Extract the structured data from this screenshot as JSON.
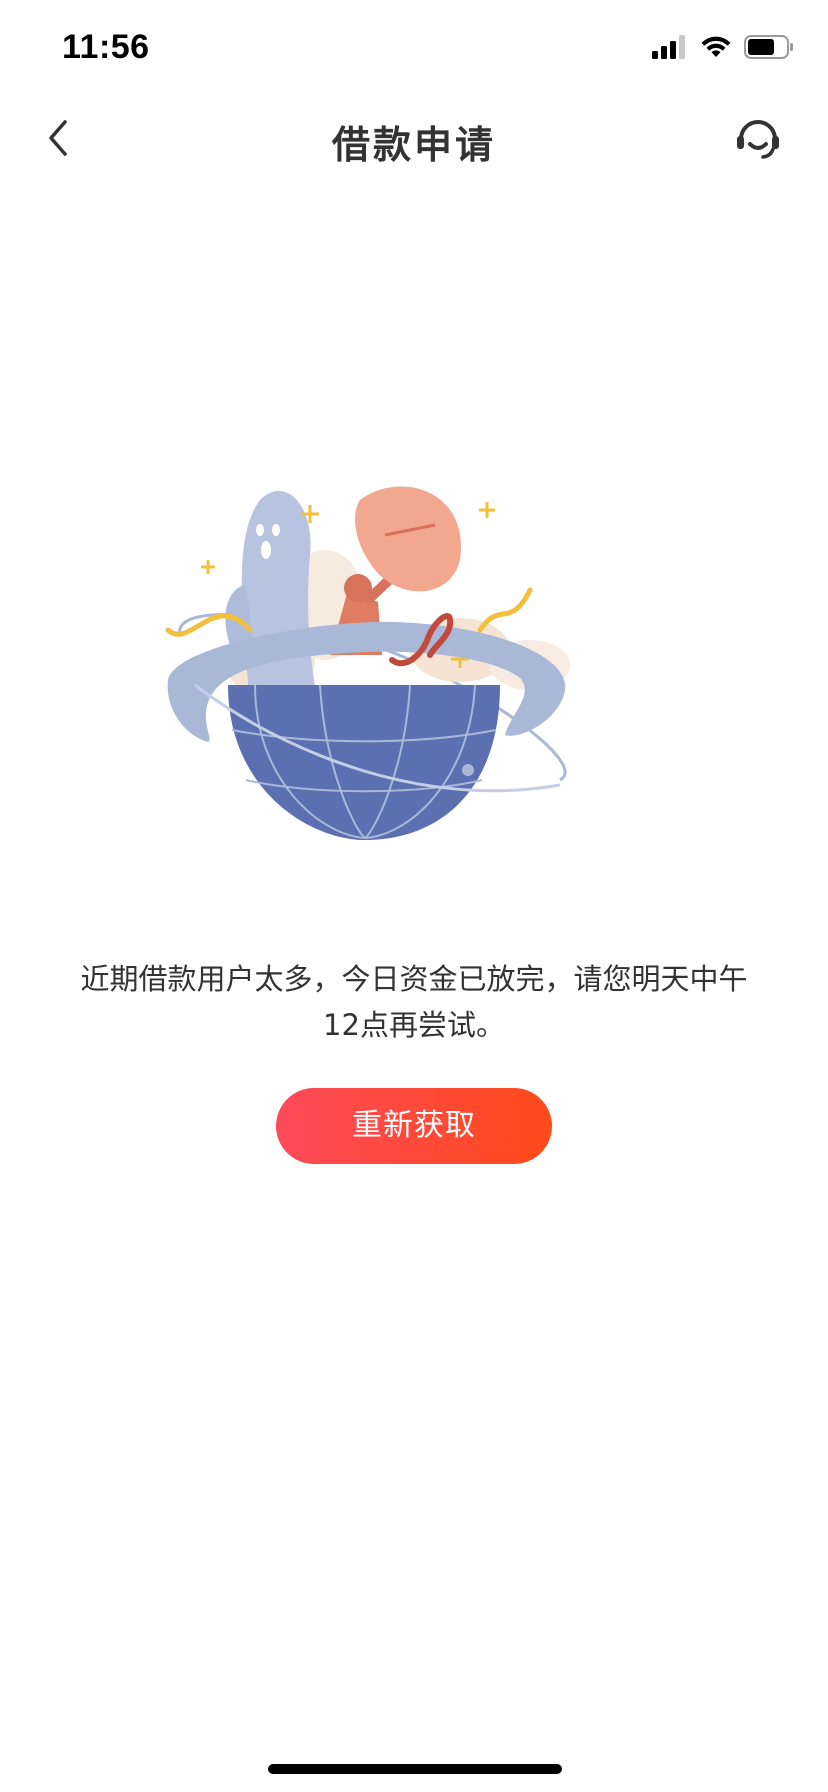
{
  "status_bar": {
    "time": "11:56",
    "icons": [
      "signal-icon",
      "wifi-icon",
      "battery-icon"
    ]
  },
  "nav": {
    "title": "借款申请",
    "back_icon": "chevron-left-icon",
    "service_icon": "customer-service-icon"
  },
  "main": {
    "message_line1": "近期借款用户太多，今日资金已放完，请您明天中午",
    "message_line2": "12点再尝试。",
    "retry_label": "重新获取"
  },
  "colors": {
    "button_gradient_start": "#fd4a5a",
    "button_gradient_end": "#ff4a1a",
    "globe_blue": "#5c6fb0",
    "ring_blue": "#aab8d8",
    "dish_peach": "#f2a88f",
    "accent_yellow": "#f4bf3c"
  }
}
